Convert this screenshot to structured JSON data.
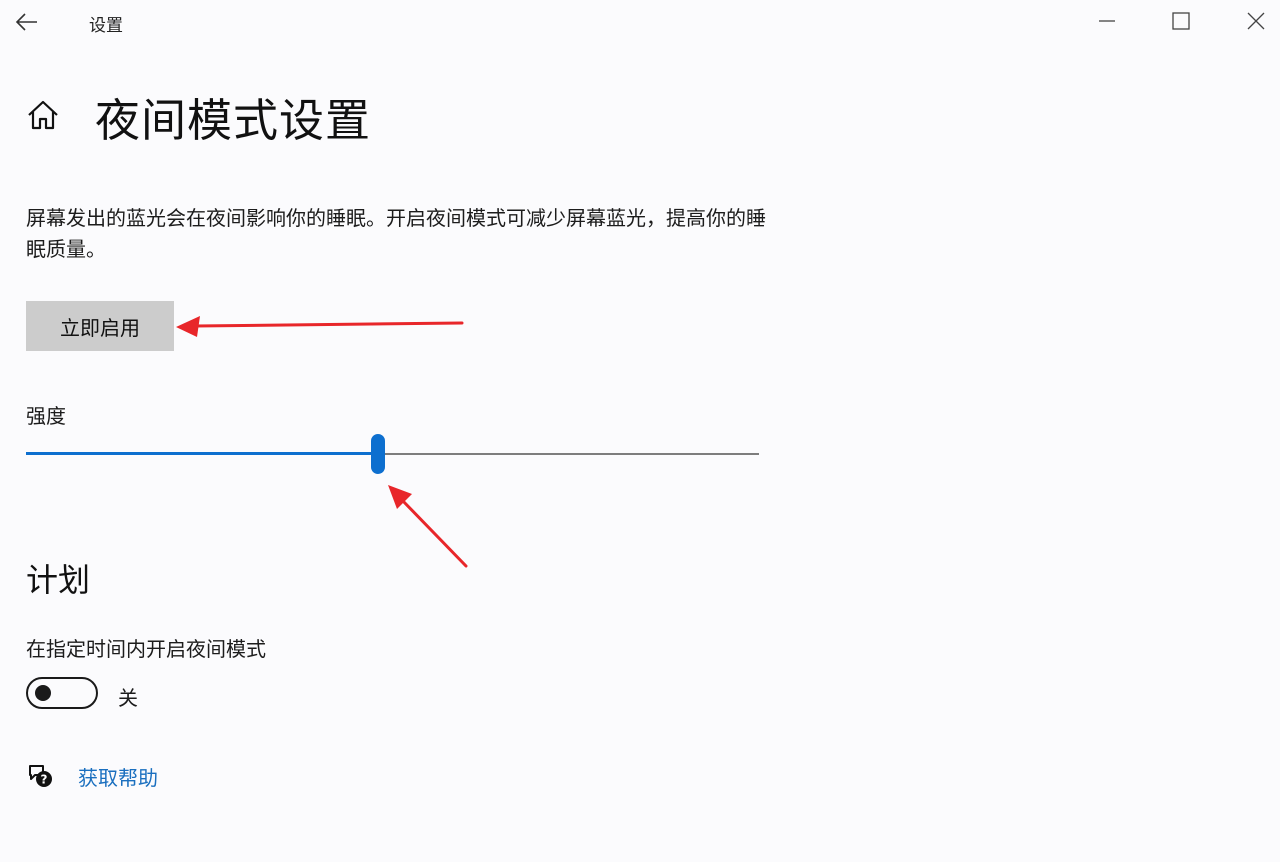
{
  "window": {
    "title": "设置"
  },
  "header": {
    "page_title": "夜间模式设置"
  },
  "content": {
    "description": "屏幕发出的蓝光会在夜间影响你的睡眠。开启夜间模式可减少屏幕蓝光，提高你的睡眠质量。",
    "enable_button_label": "立即启用",
    "strength_label": "强度",
    "strength_value_percent": 48
  },
  "schedule": {
    "section_title": "计划",
    "label": "在指定时间内开启夜间模式",
    "toggle_state_label": "关",
    "toggle_on": false
  },
  "help": {
    "link_label": "获取帮助"
  },
  "colors": {
    "accent": "#0d6fcf",
    "link": "#1a6fbf",
    "annotation_arrow": "#e8262a",
    "button_bg": "#cccccc"
  },
  "icons": {
    "back": "back-arrow-icon",
    "minimize": "minimize-icon",
    "maximize": "maximize-icon",
    "close": "close-icon",
    "home": "home-icon",
    "help": "chat-help-icon"
  }
}
